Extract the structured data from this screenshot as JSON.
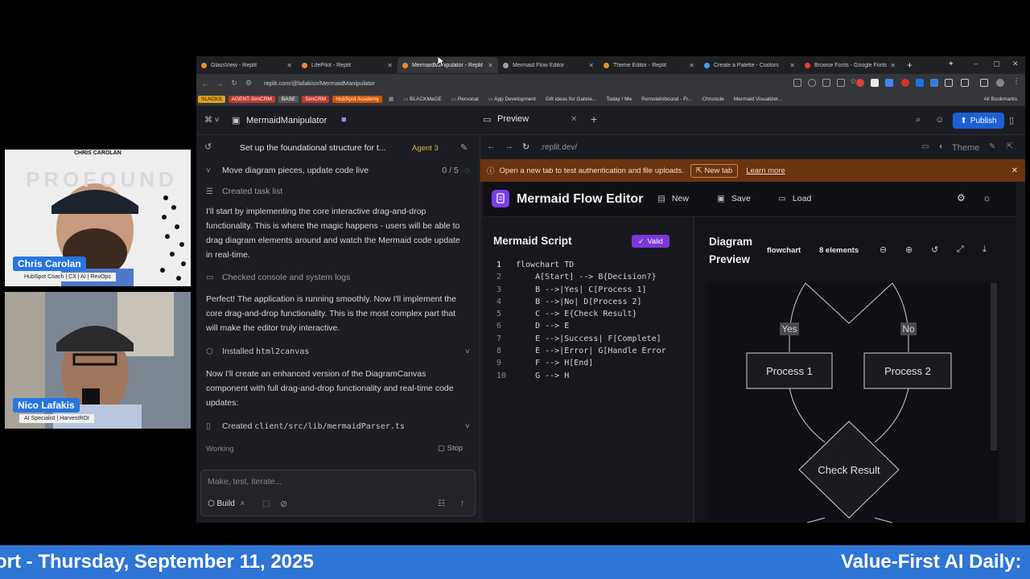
{
  "browser": {
    "tabs": [
      {
        "label": "GlassView - Replit",
        "color": "#f28c28"
      },
      {
        "label": "LifePilot - Replit",
        "color": "#f28c28"
      },
      {
        "label": "MermaidManipulator - Replit",
        "color": "#f28c28"
      },
      {
        "label": "Mermaid Flow Editor",
        "color": "#9aa0a6"
      },
      {
        "label": "Theme Editor - Replit",
        "color": "#f28c28"
      },
      {
        "label": "Create a Palette - Coolors",
        "color": "#4a9df0"
      },
      {
        "label": "Browse Fonts - Google Fonts",
        "color": "#ea4335"
      }
    ],
    "url": "replit.com/@lafakisn/MermaidManipulator",
    "bookmarks": {
      "tags": [
        {
          "label": "SLACKS",
          "color": "#e0a020"
        },
        {
          "label": "AGENT-SimCRM",
          "color": "#c0392b"
        },
        {
          "label": "BASE",
          "color": "#555"
        },
        {
          "label": "SimCRM",
          "color": "#c0392b"
        },
        {
          "label": "HubSpot Academy",
          "color": "#d35400"
        }
      ],
      "items": [
        "BLACKMaGE",
        "Personal",
        "App Development",
        "Gift ideas for Gabrie...",
        "Today / Me",
        "RemoteInbound - Fr...",
        "Chronicle",
        "Mermaid Visualizer..."
      ],
      "all_bookmarks": "All Bookmarks"
    }
  },
  "app": {
    "project_name": "MermaidManipulator",
    "preview_tab": "Preview",
    "publish_label": "Publish",
    "agent": {
      "task_title": "Set up the foundational structure for t...",
      "agent_label": "Agent 3",
      "progress_label": "Move diagram pieces, update code live",
      "progress_count": "0 / 5",
      "created_task_list": "Created task list",
      "msg1": "I'll start by implementing the core interactive drag-and-drop functionality. This is where the magic happens - users will be able to drag diagram elements around and watch the Mermaid code update in real-time.",
      "checked_logs": "Checked console and system logs",
      "msg2": "Perfect! The application is running smoothly. Now I'll implement the core drag-and-drop functionality. This is the most complex part that will make the editor truly interactive.",
      "installed_prefix": "Installed",
      "installed_pkg": "html2canvas",
      "msg3": "Now I'll create an enhanced version of the DiagramCanvas component with full drag-and-drop functionality and real-time code updates:",
      "created_prefix": "Created",
      "created_file": "client/src/lib/mermaidParser.ts",
      "working": "Working",
      "stop": "Stop",
      "input_placeholder": "Make, test, iterate...",
      "build_label": "Build"
    },
    "preview": {
      "url": ".replit.dev/",
      "theme_label": "Theme",
      "banner_text": "Open a new tab to test authentication and file uploads.",
      "new_tab_label": "New tab",
      "learn_more": "Learn more"
    }
  },
  "mermaid_editor": {
    "title": "Mermaid Flow Editor",
    "new_label": "New",
    "save_label": "Save",
    "load_label": "Load",
    "script_title": "Mermaid Script",
    "valid_label": "Valid",
    "code_lines": [
      "flowchart TD",
      "    A[Start] --> B{Decision?}",
      "    B -->|Yes| C[Process 1]",
      "    B -->|No| D[Process 2]",
      "    C --> E{Check Result}",
      "    D --> E",
      "    E -->|Success| F[Complete]",
      "    E -->|Error| G[Handle Error",
      "    F --> H[End]",
      "    G --> H"
    ],
    "line_numbers": [
      "1",
      "2",
      "3",
      "4",
      "5",
      "6",
      "7",
      "8",
      "9",
      "10"
    ],
    "diagram_title": "Diagram Preview",
    "diagram_type": "flowchart",
    "element_count": "8 elements",
    "nodes": {
      "process1": "Process 1",
      "process2": "Process 2",
      "check": "Check Result",
      "yes": "Yes",
      "no": "No"
    }
  },
  "webcams": [
    {
      "name": "Chris Carolan",
      "role": "HubSpot Coach | CX | AI | RevOps",
      "overlay_title": "CHRIS CAROLAN",
      "watermark": "PROFOUND"
    },
    {
      "name": "Nico Lafakis",
      "role": "AI Specialist | HarvestROI"
    }
  ],
  "ticker": {
    "left": "ort - Thursday, September 11, 2025",
    "right": "Value-First AI Daily:"
  }
}
